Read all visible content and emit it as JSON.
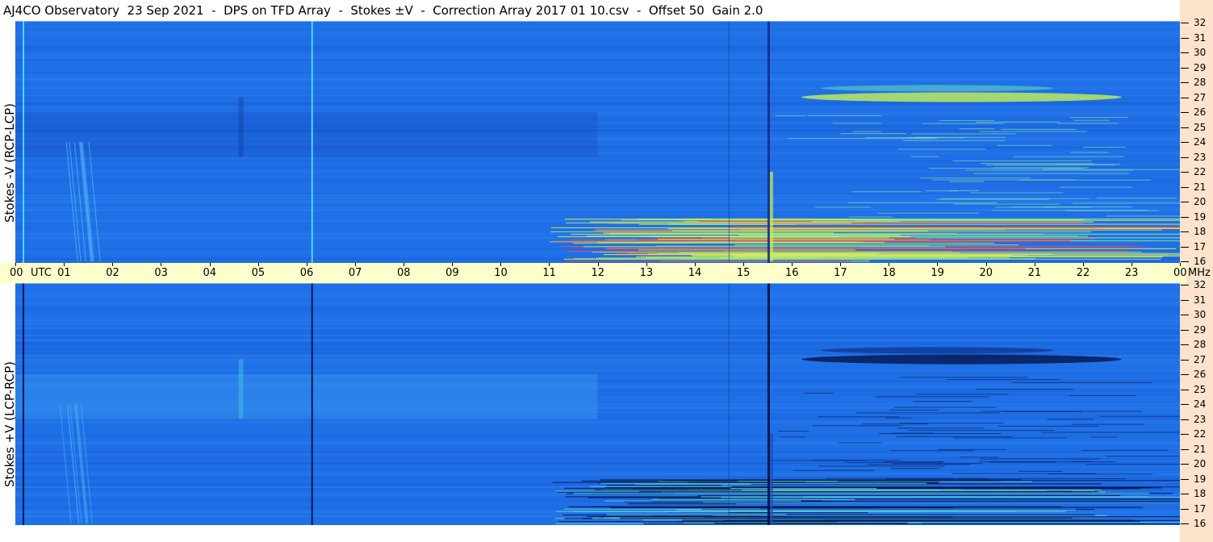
{
  "chart_data": {
    "type": "heatmap",
    "title": "AJ4CO Observatory  23 Sep 2021  -  DPS on TFD Array  -  Stokes ±V  -  Correction Array 2017 01 10.csv  -  Offset 50  Gain 2.0",
    "xlabel": "UTC",
    "x_ticks": [
      "00",
      "01",
      "02",
      "03",
      "04",
      "05",
      "06",
      "07",
      "08",
      "09",
      "10",
      "11",
      "12",
      "13",
      "14",
      "15",
      "16",
      "17",
      "18",
      "19",
      "20",
      "21",
      "22",
      "23",
      "00"
    ],
    "x_unit": "UTC",
    "y_unit": "MHz",
    "y_ticks": [
      32,
      31,
      30,
      29,
      28,
      27,
      26,
      25,
      24,
      23,
      22,
      21,
      20,
      19,
      18,
      17,
      16
    ],
    "ylim": [
      16,
      32
    ],
    "panels": [
      {
        "ylabel": "Stokes -V  (RCP-LCP)",
        "polarity": "negative"
      },
      {
        "ylabel": "Stokes +V  (LCP-RCP)",
        "polarity": "positive"
      }
    ],
    "colors": {
      "background": "#1f6fe6",
      "band_bg": "#ffffcc",
      "side_bg": "#fde3cc"
    }
  }
}
